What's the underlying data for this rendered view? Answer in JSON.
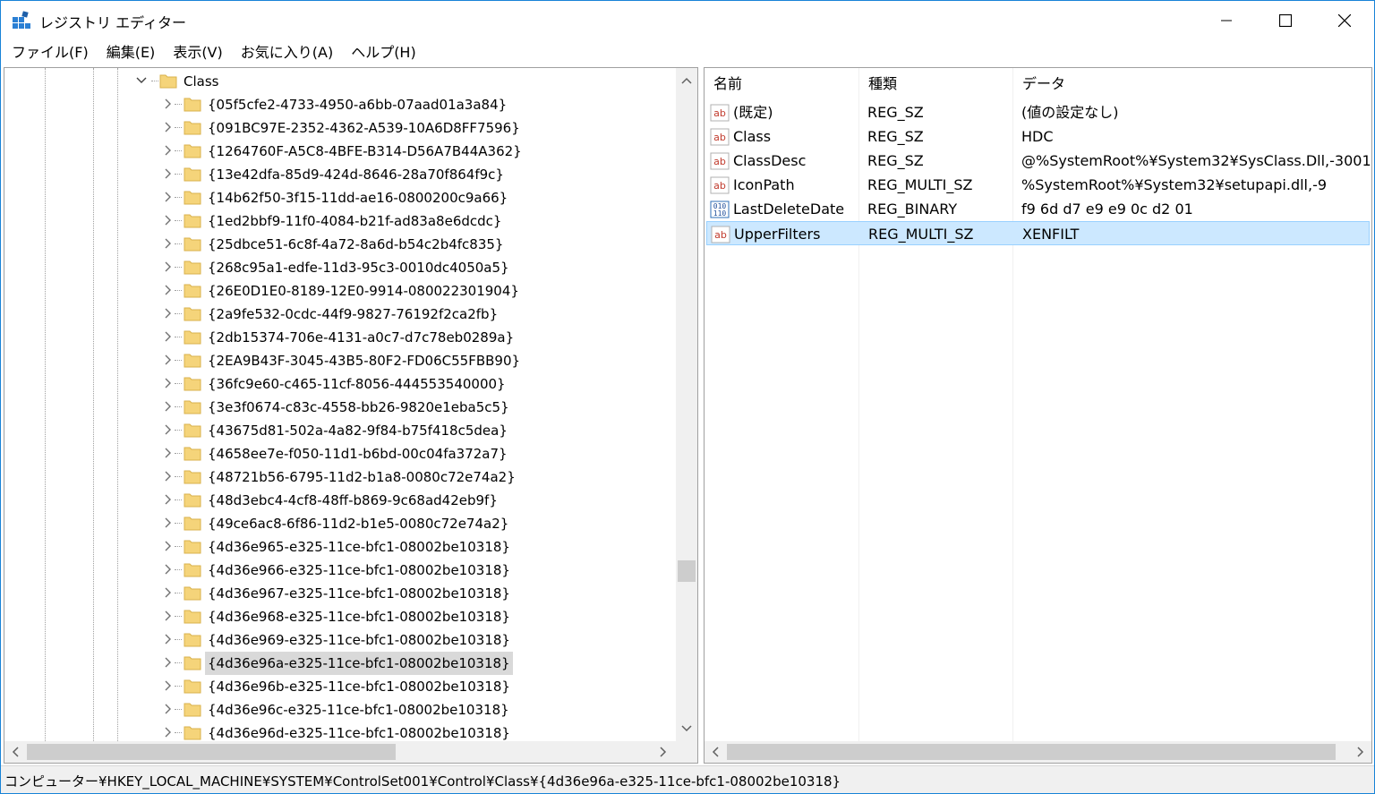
{
  "window": {
    "title": "レジストリ エディター"
  },
  "menu": [
    {
      "label": "ファイル(F)"
    },
    {
      "label": "編集(E)"
    },
    {
      "label": "表示(V)"
    },
    {
      "label": "お気に入り(A)"
    },
    {
      "label": "ヘルプ(H)"
    }
  ],
  "tree": {
    "parent": {
      "label": "Class",
      "expanded": true
    },
    "items": [
      {
        "label": "{05f5cfe2-4733-4950-a6bb-07aad01a3a84}",
        "selected": false
      },
      {
        "label": "{091BC97E-2352-4362-A539-10A6D8FF7596}",
        "selected": false
      },
      {
        "label": "{1264760F-A5C8-4BFE-B314-D56A7B44A362}",
        "selected": false
      },
      {
        "label": "{13e42dfa-85d9-424d-8646-28a70f864f9c}",
        "selected": false
      },
      {
        "label": "{14b62f50-3f15-11dd-ae16-0800200c9a66}",
        "selected": false
      },
      {
        "label": "{1ed2bbf9-11f0-4084-b21f-ad83a8e6dcdc}",
        "selected": false
      },
      {
        "label": "{25dbce51-6c8f-4a72-8a6d-b54c2b4fc835}",
        "selected": false
      },
      {
        "label": "{268c95a1-edfe-11d3-95c3-0010dc4050a5}",
        "selected": false
      },
      {
        "label": "{26E0D1E0-8189-12E0-9914-080022301904}",
        "selected": false
      },
      {
        "label": "{2a9fe532-0cdc-44f9-9827-76192f2ca2fb}",
        "selected": false
      },
      {
        "label": "{2db15374-706e-4131-a0c7-d7c78eb0289a}",
        "selected": false
      },
      {
        "label": "{2EA9B43F-3045-43B5-80F2-FD06C55FBB90}",
        "selected": false
      },
      {
        "label": "{36fc9e60-c465-11cf-8056-444553540000}",
        "selected": false
      },
      {
        "label": "{3e3f0674-c83c-4558-bb26-9820e1eba5c5}",
        "selected": false
      },
      {
        "label": "{43675d81-502a-4a82-9f84-b75f418c5dea}",
        "selected": false
      },
      {
        "label": "{4658ee7e-f050-11d1-b6bd-00c04fa372a7}",
        "selected": false
      },
      {
        "label": "{48721b56-6795-11d2-b1a8-0080c72e74a2}",
        "selected": false
      },
      {
        "label": "{48d3ebc4-4cf8-48ff-b869-9c68ad42eb9f}",
        "selected": false
      },
      {
        "label": "{49ce6ac8-6f86-11d2-b1e5-0080c72e74a2}",
        "selected": false
      },
      {
        "label": "{4d36e965-e325-11ce-bfc1-08002be10318}",
        "selected": false
      },
      {
        "label": "{4d36e966-e325-11ce-bfc1-08002be10318}",
        "selected": false
      },
      {
        "label": "{4d36e967-e325-11ce-bfc1-08002be10318}",
        "selected": false
      },
      {
        "label": "{4d36e968-e325-11ce-bfc1-08002be10318}",
        "selected": false
      },
      {
        "label": "{4d36e969-e325-11ce-bfc1-08002be10318}",
        "selected": false
      },
      {
        "label": "{4d36e96a-e325-11ce-bfc1-08002be10318}",
        "selected": true
      },
      {
        "label": "{4d36e96b-e325-11ce-bfc1-08002be10318}",
        "selected": false
      },
      {
        "label": "{4d36e96c-e325-11ce-bfc1-08002be10318}",
        "selected": false
      },
      {
        "label": "{4d36e96d-e325-11ce-bfc1-08002be10318}",
        "selected": false
      }
    ]
  },
  "list": {
    "columns": [
      {
        "label": "名前"
      },
      {
        "label": "種類"
      },
      {
        "label": "データ"
      }
    ],
    "rows": [
      {
        "icon": "string-value-icon",
        "name": "(既定)",
        "type": "REG_SZ",
        "data": "(値の設定なし)",
        "selected": false
      },
      {
        "icon": "string-value-icon",
        "name": "Class",
        "type": "REG_SZ",
        "data": "HDC",
        "selected": false
      },
      {
        "icon": "string-value-icon",
        "name": "ClassDesc",
        "type": "REG_SZ",
        "data": "@%SystemRoot%¥System32¥SysClass.Dll,-3001",
        "selected": false
      },
      {
        "icon": "string-value-icon",
        "name": "IconPath",
        "type": "REG_MULTI_SZ",
        "data": "%SystemRoot%¥System32¥setupapi.dll,-9",
        "selected": false
      },
      {
        "icon": "binary-value-icon",
        "name": "LastDeleteDate",
        "type": "REG_BINARY",
        "data": "f9 6d d7 e9 e9 0c d2 01",
        "selected": false
      },
      {
        "icon": "string-value-icon",
        "name": "UpperFilters",
        "type": "REG_MULTI_SZ",
        "data": "XENFILT",
        "selected": true
      }
    ]
  },
  "status": {
    "path": "コンピューター¥HKEY_LOCAL_MACHINE¥SYSTEM¥ControlSet001¥Control¥Class¥{4d36e96a-e325-11ce-bfc1-08002be10318}"
  },
  "colors": {
    "accent": "#1883d7",
    "folder": "#f5d47a",
    "selection_list": "#cce8ff",
    "selection_tree": "#d9d9d9",
    "chrome": "#f0f0f0"
  }
}
